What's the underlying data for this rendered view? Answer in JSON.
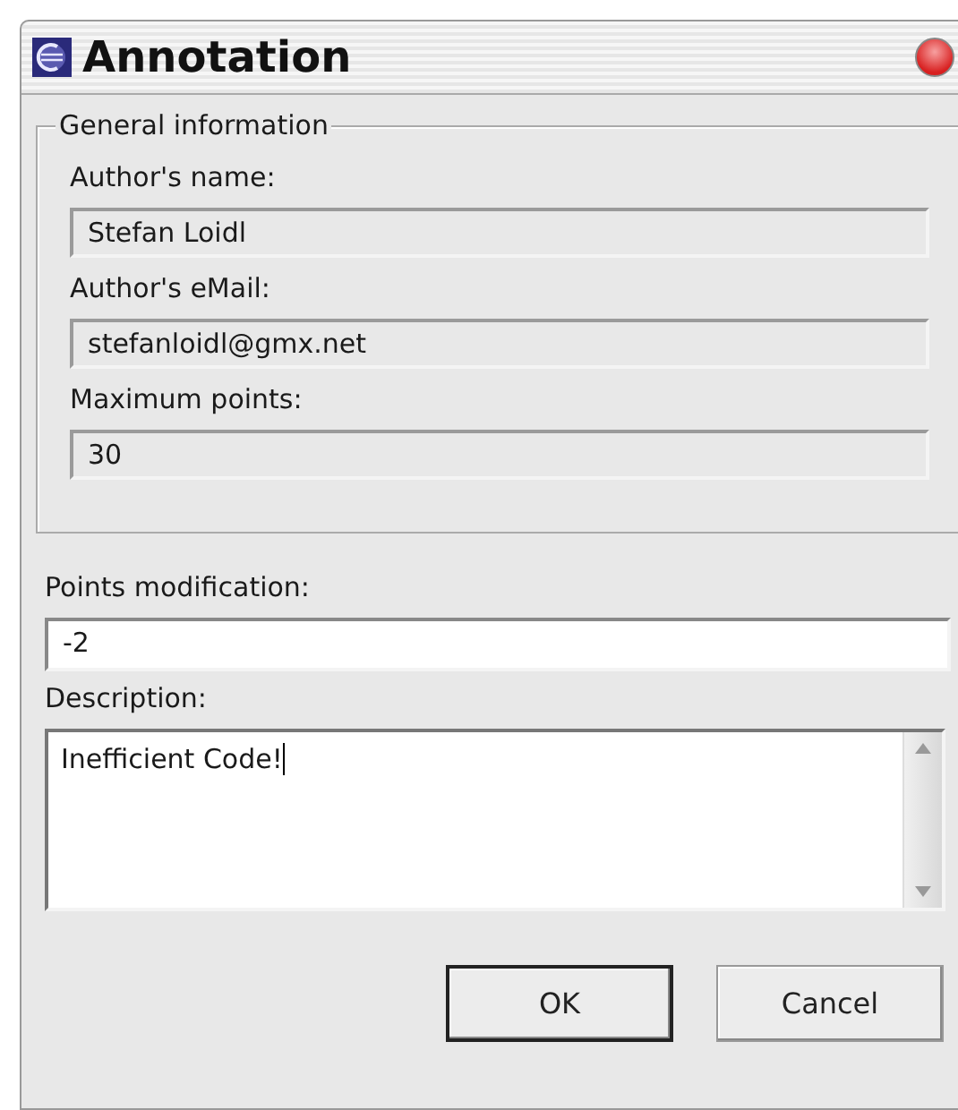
{
  "window": {
    "title": "Annotation"
  },
  "group": {
    "title": "General information",
    "fields": [
      {
        "label": "Author's name:",
        "value": "Stefan Loidl",
        "readonly": true
      },
      {
        "label": "Author's eMail:",
        "value": "stefanloidl@gmx.net",
        "readonly": true
      },
      {
        "label": "Maximum points:",
        "value": "30",
        "readonly": true
      }
    ]
  },
  "points": {
    "label": "Points modification:",
    "value": "-2",
    "readonly": false
  },
  "description": {
    "label": "Description:",
    "value": "Inefficient Code!",
    "focused": true
  },
  "buttons": [
    {
      "label": "OK",
      "default": true
    },
    {
      "label": "Cancel",
      "default": false
    }
  ]
}
